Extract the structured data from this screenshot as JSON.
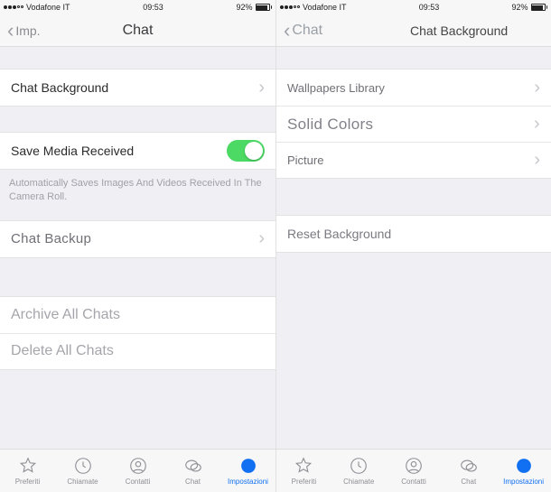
{
  "left": {
    "status": {
      "carrier": "Vodafone IT",
      "time": "09:53",
      "battery": "92%"
    },
    "nav": {
      "back": "Imp.",
      "title": "Chat"
    },
    "chat_background": "Chat Background",
    "save_media": "Save Media Received",
    "save_media_note": "Automatically Saves Images And Videos Received In The Camera Roll.",
    "chat_backup": "Chat Backup",
    "archive_all": "Archive All Chats",
    "delete_all": "Delete All Chats"
  },
  "right": {
    "status": {
      "carrier": "Vodafone IT",
      "time": "09:53",
      "battery": "92%"
    },
    "nav": {
      "back": "Chat",
      "title": "Chat Background"
    },
    "wallpapers_library": "Wallpapers Library",
    "solid_colors": "Solid Colors",
    "picture": "Picture",
    "reset_background": "Reset Background"
  },
  "tabs": {
    "preferiti": "Preferiti",
    "chiamate": "Chiamate",
    "contatti": "Contatti",
    "chat": "Chat",
    "impostazioni": "Impostazioni"
  }
}
